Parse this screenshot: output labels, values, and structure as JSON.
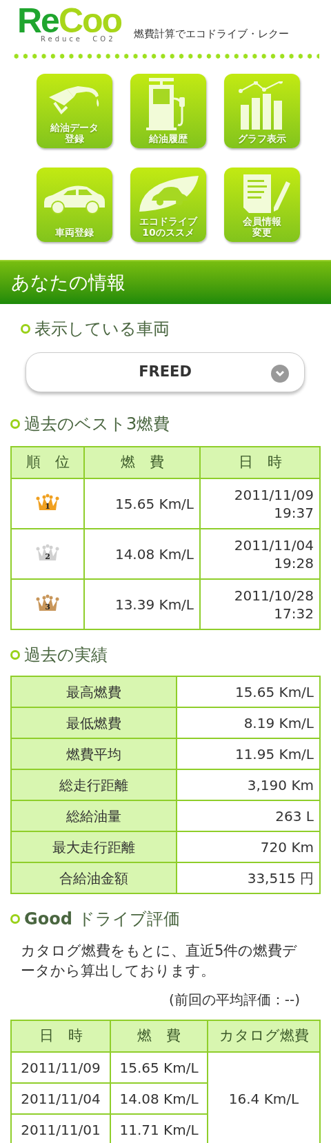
{
  "header": {
    "logo_main_1": "Re",
    "logo_main_2": "Coo",
    "logo_sub": "Reduce  CO2",
    "tagline": "燃費計算でエコドライブ・レクー"
  },
  "menu": [
    {
      "kind": "nozzle",
      "label": [
        "給油データ",
        "登録"
      ]
    },
    {
      "kind": "pump",
      "label": [
        "給油履歴"
      ]
    },
    {
      "kind": "chart",
      "label": [
        "グラフ表示"
      ]
    },
    {
      "kind": "car",
      "label": [
        "車両登録"
      ]
    },
    {
      "kind": "leaf",
      "label": [
        "エコドライブ",
        "10のススメ"
      ]
    },
    {
      "kind": "document",
      "label": [
        "会員情報",
        "変更"
      ]
    }
  ],
  "section_title": "あなたの情報",
  "vehicle": {
    "heading": "表示している車両",
    "value": "FREED"
  },
  "best3": {
    "heading": "過去のベスト3燃費",
    "columns": [
      "順　位",
      "燃　費",
      "日　時"
    ],
    "rows": [
      {
        "rank": "1",
        "color": "#f0a020",
        "mileage": "15.65 Km/L",
        "date": "2011/11/09",
        "time": "19:37"
      },
      {
        "rank": "2",
        "color": "#d0d0d0",
        "mileage": "14.08 Km/L",
        "date": "2011/11/04",
        "time": "19:28"
      },
      {
        "rank": "3",
        "color": "#c8965a",
        "mileage": "13.39 Km/L",
        "date": "2011/10/28",
        "time": "17:32"
      }
    ]
  },
  "record": {
    "heading": "過去の実績",
    "rows": [
      {
        "label": "最高燃費",
        "value": "15.65 Km/L"
      },
      {
        "label": "最低燃費",
        "value": "8.19 Km/L"
      },
      {
        "label": "燃費平均",
        "value": "11.95 Km/L"
      },
      {
        "label": "総走行距離",
        "value": "3,190 Km"
      },
      {
        "label": "総給油量",
        "value": "263 L"
      },
      {
        "label": "最大走行距離",
        "value": "720 Km"
      },
      {
        "label": "合給油金額",
        "value": "33,515 円"
      }
    ]
  },
  "good": {
    "heading_bold": "Good",
    "heading_rest": "ドライブ評価",
    "description": "カタログ燃費をもとに、直近5件の燃費データから算出しております。",
    "previous": "(前回の平均評価：--)",
    "columns": [
      "日　時",
      "燃　費",
      "カタログ燃費"
    ],
    "rows": [
      {
        "date": "2011/11/09",
        "mileage": "15.65 Km/L"
      },
      {
        "date": "2011/11/04",
        "mileage": "14.08 Km/L"
      },
      {
        "date": "2011/11/01",
        "mileage": "11.71 Km/L"
      }
    ],
    "catalog": "16.4 Km/L"
  }
}
